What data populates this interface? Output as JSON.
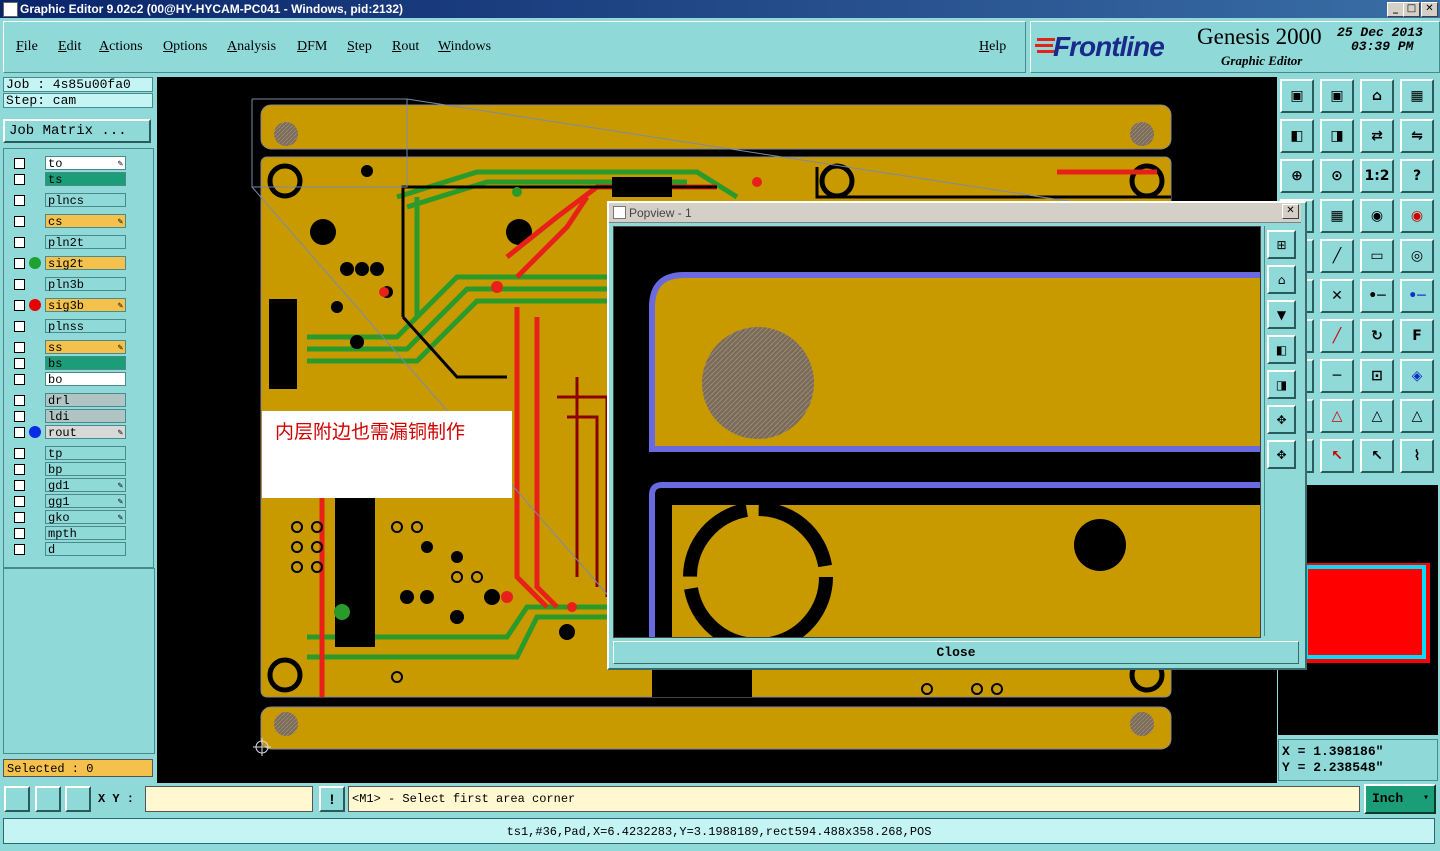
{
  "window": {
    "title": "Graphic Editor 9.02c2 (00@HY-HYCAM-PC041 - Windows, pid:2132)",
    "min": "_",
    "max": "□",
    "close": "✕"
  },
  "menu": {
    "file": "File",
    "edit": "Edit",
    "actions": "Actions",
    "options": "Options",
    "analysis": "Analysis",
    "dfm": "DFM",
    "step": "Step",
    "rout": "Rout",
    "windows": "Windows",
    "help": "Help"
  },
  "branding": {
    "logo": "Frontline",
    "product": "Genesis 2000",
    "subtitle": "Graphic Editor",
    "date": "25 Dec 2013",
    "time": "03:39 PM"
  },
  "job": {
    "job_label": "Job : 4s85u00fa0",
    "step_label": "Step: cam",
    "matrix_button": "Job Matrix ..."
  },
  "layers": [
    {
      "name": "to",
      "color": "#ffffff",
      "editable": true,
      "dot": ""
    },
    {
      "name": "ts",
      "color": "#1b9e77",
      "editable": false,
      "dot": ""
    },
    {
      "name": "plncs",
      "color": "#8fd9d9",
      "editable": false,
      "dot": ""
    },
    {
      "name": "cs",
      "color": "#f4c14c",
      "editable": true,
      "dot": ""
    },
    {
      "name": "pln2t",
      "color": "#8fd9d9",
      "editable": false,
      "dot": ""
    },
    {
      "name": "sig2t",
      "color": "#f4c14c",
      "editable": false,
      "dot": "#1fa030"
    },
    {
      "name": "pln3b",
      "color": "#8fd9d9",
      "editable": false,
      "dot": ""
    },
    {
      "name": "sig3b",
      "color": "#f4c14c",
      "editable": true,
      "dot": "#e60000"
    },
    {
      "name": "plnss",
      "color": "#8fd9d9",
      "editable": false,
      "dot": ""
    },
    {
      "name": "ss",
      "color": "#f4c14c",
      "editable": true,
      "dot": ""
    },
    {
      "name": "bs",
      "color": "#1b9e77",
      "editable": false,
      "dot": ""
    },
    {
      "name": "bo",
      "color": "#ffffff",
      "editable": false,
      "dot": ""
    },
    {
      "name": "drl",
      "color": "#b0c4c4",
      "editable": false,
      "dot": ""
    },
    {
      "name": "ldi",
      "color": "#b0c4c4",
      "editable": false,
      "dot": ""
    },
    {
      "name": "rout",
      "color": "#d8d8d8",
      "editable": true,
      "dot": "#0a2ae6"
    },
    {
      "name": "tp",
      "color": "#8fd9d9",
      "editable": false,
      "dot": ""
    },
    {
      "name": "bp",
      "color": "#8fd9d9",
      "editable": false,
      "dot": ""
    },
    {
      "name": "gd1",
      "color": "#8fd9d9",
      "editable": true,
      "dot": ""
    },
    {
      "name": "gg1",
      "color": "#8fd9d9",
      "editable": true,
      "dot": ""
    },
    {
      "name": "gko",
      "color": "#8fd9d9",
      "editable": true,
      "dot": ""
    },
    {
      "name": "mpth",
      "color": "#8fd9d9",
      "editable": false,
      "dot": ""
    },
    {
      "name": "d",
      "color": "#8fd9d9",
      "editable": false,
      "dot": ""
    }
  ],
  "selected": "Selected : 0",
  "annotation": "内层附边也需漏铜制作",
  "popview": {
    "title": "Popview - 1",
    "close_label": "Close"
  },
  "coords": {
    "x": "X = 1.398186\"",
    "y": "Y = 2.238548\""
  },
  "command": {
    "xy_label": "X Y :",
    "xy_value": "",
    "exclaim": "!",
    "prompt": "<M1> - Select first area corner",
    "units": "Inch"
  },
  "status": "ts1,#36,Pad,X=6.4232283,Y=3.1988189,rect594.488x358.268,POS",
  "colors": {
    "copper": "#c89a00",
    "signal_red": "#e8201a",
    "signal_green": "#2a9a2a",
    "panel": "#8fd9d9"
  }
}
